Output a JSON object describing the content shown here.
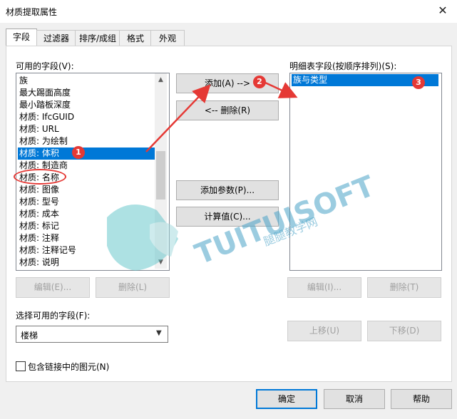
{
  "window": {
    "title": "材质提取属性",
    "close": "✕"
  },
  "tabs": [
    {
      "label": "字段"
    },
    {
      "label": "过滤器"
    },
    {
      "label": "排序/成组"
    },
    {
      "label": "格式"
    },
    {
      "label": "外观"
    }
  ],
  "available": {
    "label": "可用的字段(V):",
    "items": [
      "族",
      "最大踢面高度",
      "最小踏板深度",
      "材质: IfcGUID",
      "材质: URL",
      "材质: 为绘制",
      "材质: 体积",
      "材质: 制造商",
      "材质: 名称",
      "材质: 图像",
      "材质: 型号",
      "材质: 成本",
      "材质: 标记",
      "材质: 注释",
      "材质: 注释记号",
      "材质: 说明"
    ],
    "selected_index": 6,
    "edit_button": "编辑(E)...",
    "delete_button": "删除(L)",
    "select_label": "选择可用的字段(F):",
    "select_value": "楼梯",
    "include_linked": "包含链接中的图元(N)"
  },
  "middle": {
    "add": "添加(A) -->",
    "remove": "<-- 删除(R)",
    "add_param": "添加参数(P)...",
    "calc": "计算值(C)..."
  },
  "schedule": {
    "label": "明细表字段(按顺序排列)(S):",
    "items": [
      "族与类型"
    ],
    "edit_button": "编辑(I)...",
    "delete_button": "删除(T)",
    "up_button": "上移(U)",
    "down_button": "下移(D)"
  },
  "footer": {
    "ok": "确定",
    "cancel": "取消",
    "help": "帮助"
  },
  "annotations": {
    "badge1": "1",
    "badge2": "2",
    "badge3": "3",
    "accent": "#e53935"
  },
  "watermark": {
    "brand": "TUITUISOFT",
    "sub": "腿腿教学网"
  }
}
